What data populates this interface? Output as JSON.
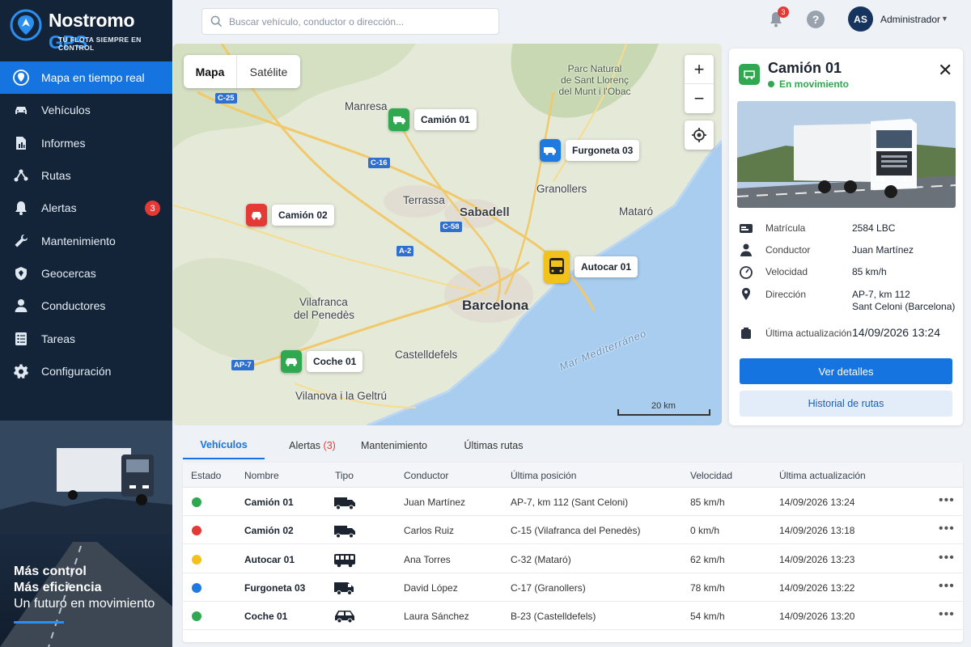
{
  "brand": {
    "name_main": "Nostromo",
    "name_accent": "GPS",
    "tagline": "TU FLOTA SIEMPRE EN CONTROL"
  },
  "nav": [
    {
      "label": "Mapa en tiempo real",
      "icon": "map-pin-icon",
      "active": true
    },
    {
      "label": "Vehículos",
      "icon": "car-icon"
    },
    {
      "label": "Informes",
      "icon": "report-icon"
    },
    {
      "label": "Rutas",
      "icon": "route-icon"
    },
    {
      "label": "Alertas",
      "icon": "bell-icon",
      "badge": "3"
    },
    {
      "label": "Mantenimiento",
      "icon": "wrench-icon"
    },
    {
      "label": "Geocercas",
      "icon": "shield-icon"
    },
    {
      "label": "Conductores",
      "icon": "user-icon"
    },
    {
      "label": "Tareas",
      "icon": "tasks-icon"
    },
    {
      "label": "Configuración",
      "icon": "gear-icon"
    }
  ],
  "promo": {
    "line1": "Más control",
    "line2": "Más eficiencia",
    "line3": "Un futuro en movimiento"
  },
  "topbar": {
    "search_placeholder": "Buscar vehículo, conductor o dirección...",
    "notifications": "3",
    "avatar_initials": "AS",
    "user_name": "Administrador"
  },
  "map": {
    "toggle": {
      "map": "Mapa",
      "satellite": "Satélite"
    },
    "zoom_in": "+",
    "zoom_out": "−",
    "places": {
      "manresa": "Manresa",
      "terrassa": "Terrassa",
      "sabadell": "Sabadell",
      "granollers": "Granollers",
      "mataro": "Mataró",
      "barcelona": "Barcelona",
      "vilafranca_1": "Vilafranca",
      "vilafranca_2": "del Penedès",
      "castelldefels": "Castelldefels",
      "vilanova": "Vilanova i la Geltrú",
      "park_1": "Parc Natural",
      "park_2": "de Sant Llorenç",
      "park_3": "del Munt i l'Obac",
      "sea": "Mar Mediterráneo"
    },
    "roads": {
      "c25": "C-25",
      "c16": "C-16",
      "c58": "C-58",
      "a2": "A-2",
      "ap7": "AP-7"
    },
    "markers": {
      "camion01": "Camión 01",
      "furgoneta03": "Furgoneta 03",
      "camion02": "Camión 02",
      "autocar01": "Autocar 01",
      "coche01": "Coche 01"
    },
    "marker_colors": {
      "green": "#2fa84f",
      "blue": "#1e7ae0",
      "red": "#e53935",
      "yellow": "#f2c21b"
    },
    "scale": "20 km"
  },
  "details": {
    "title": "Camión 01",
    "status": "En movimiento",
    "plate_label": "Matrícula",
    "plate": "2584 LBC",
    "driver_label": "Conductor",
    "driver": "Juan Martínez",
    "speed_label": "Velocidad",
    "speed": "85 km/h",
    "address_label": "Dirección",
    "address_1": "AP-7, km 112",
    "address_2": "Sant Celoni (Barcelona)",
    "updated_label": "Última actualización",
    "updated": "14/09/2026 13:24",
    "btn_details": "Ver detalles",
    "btn_history": "Historial de rutas"
  },
  "tabs": {
    "vehicles": "Vehículos",
    "alerts": "Alertas",
    "alerts_count": "(3)",
    "maintenance": "Mantenimiento",
    "routes": "Últimas rutas"
  },
  "table": {
    "headers": {
      "estado": "Estado",
      "nombre": "Nombre",
      "tipo": "Tipo",
      "conductor": "Conductor",
      "posicion": "Última posición",
      "velocidad": "Velocidad",
      "actualizacion": "Última actualización"
    },
    "rows": [
      {
        "status_color": "#2fa84f",
        "name": "Camión 01",
        "type": "truck-icon",
        "driver": "Juan Martínez",
        "position": "AP-7, km 112 (Sant Celoni)",
        "speed": "85 km/h",
        "updated": "14/09/2026 13:24"
      },
      {
        "status_color": "#e53935",
        "name": "Camión 02",
        "type": "truck-icon",
        "driver": "Carlos Ruiz",
        "position": "C-15 (Vilafranca del Penedès)",
        "speed": "0 km/h",
        "updated": "14/09/2026 13:18"
      },
      {
        "status_color": "#f2c21b",
        "name": "Autocar 01",
        "type": "bus-icon",
        "driver": "Ana Torres",
        "position": "C-32 (Mataró)",
        "speed": "62 km/h",
        "updated": "14/09/2026 13:23"
      },
      {
        "status_color": "#1e7ae0",
        "name": "Furgoneta 03",
        "type": "van-icon",
        "driver": "David López",
        "position": "C-17 (Granollers)",
        "speed": "78 km/h",
        "updated": "14/09/2026 13:22"
      },
      {
        "status_color": "#2fa84f",
        "name": "Coche 01",
        "type": "car-icon",
        "driver": "Laura Sánchez",
        "position": "B-23 (Castelldefels)",
        "speed": "54 km/h",
        "updated": "14/09/2026 13:20"
      }
    ]
  },
  "colors": {
    "accent": "#1674e0",
    "sidebar": "#132439",
    "badge": "#e53935"
  }
}
